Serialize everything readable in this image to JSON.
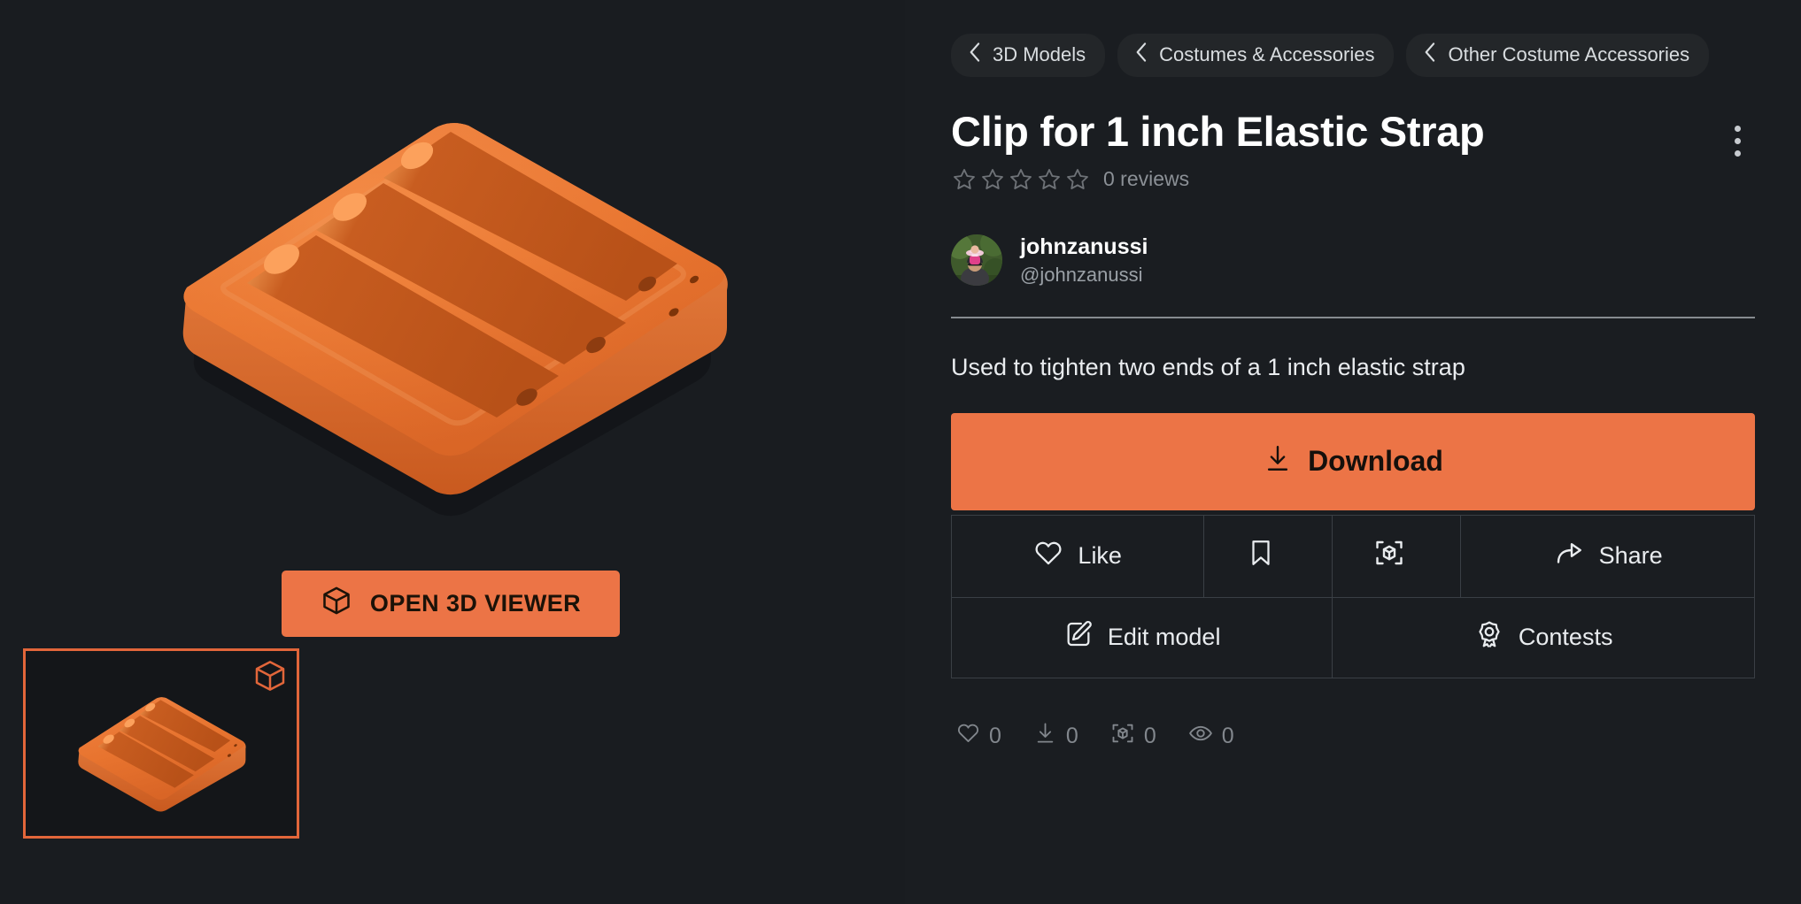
{
  "viewer": {
    "open_viewer_label": "OPEN 3D VIEWER",
    "open_viewer_icon": "cube-icon",
    "thumbnail_badge_icon": "cube-icon",
    "model_color": "#e8772f",
    "background_color": "#191c20",
    "thumbnail_border_color": "#e2663a"
  },
  "breadcrumbs": [
    {
      "label": "3D Models",
      "icon": "chevron-left-icon"
    },
    {
      "label": "Costumes & Accessories",
      "icon": "chevron-left-icon"
    },
    {
      "label": "Other Costume Accessories",
      "icon": "chevron-left-icon"
    }
  ],
  "header": {
    "title": "Clip for 1 inch Elastic Strap",
    "rating": 0,
    "stars_total": 5,
    "reviews_text": "0 reviews",
    "menu_icon": "kebab-menu-icon"
  },
  "author": {
    "name": "johnzanussi",
    "handle": "@johnzanussi",
    "avatar_icon": "avatar-photo"
  },
  "description": "Used to tighten two ends of a 1 inch elastic strap",
  "download": {
    "label": "Download",
    "icon": "download-icon",
    "color": "#ec7446"
  },
  "actions": [
    [
      {
        "label": "Like",
        "icon": "heart-icon",
        "name": "like-button"
      },
      {
        "label": "",
        "icon": "bookmark-icon",
        "name": "save-button"
      },
      {
        "label": "",
        "icon": "ar-cube-icon",
        "name": "ar-view-button"
      },
      {
        "label": "Share",
        "icon": "share-icon",
        "name": "share-button"
      }
    ],
    [
      {
        "label": "Edit model",
        "icon": "pencil-square-icon",
        "name": "edit-model-button"
      },
      {
        "label": "Contests",
        "icon": "award-ribbon-icon",
        "name": "contests-button"
      }
    ]
  ],
  "stats": [
    {
      "icon": "heart-icon",
      "value": "0",
      "name": "likes-count"
    },
    {
      "icon": "download-icon",
      "value": "0",
      "name": "downloads-count"
    },
    {
      "icon": "ar-cube-icon",
      "value": "0",
      "name": "ar-views-count"
    },
    {
      "icon": "eye-icon",
      "value": "0",
      "name": "views-count"
    }
  ]
}
